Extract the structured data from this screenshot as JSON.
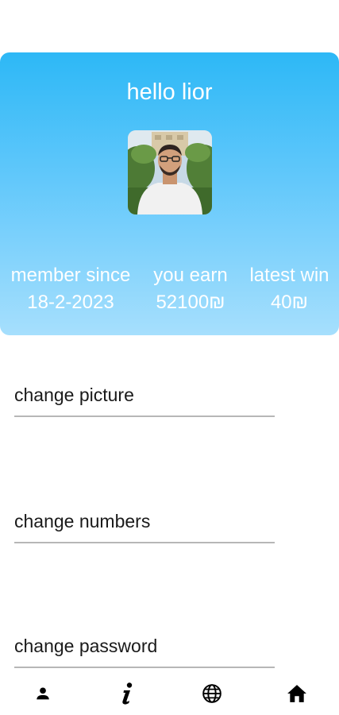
{
  "profile": {
    "greeting": "hello lior",
    "avatar_icon": "user-photo",
    "stats": [
      {
        "label": "member since",
        "value": "18-2-2023"
      },
      {
        "label": "you earn",
        "value": "52100₪"
      },
      {
        "label": "latest win",
        "value": "40₪"
      }
    ]
  },
  "settings": {
    "change_picture": "change picture",
    "change_numbers": "change numbers",
    "change_password": "change password"
  },
  "nav": {
    "profile_icon": "person-icon",
    "info_icon": "info-icon",
    "globe_icon": "globe-icon",
    "home_icon": "home-icon"
  },
  "colors": {
    "card_top": "#2db8f6",
    "card_bottom": "#a6dffd",
    "divider": "#b7b7b7"
  }
}
